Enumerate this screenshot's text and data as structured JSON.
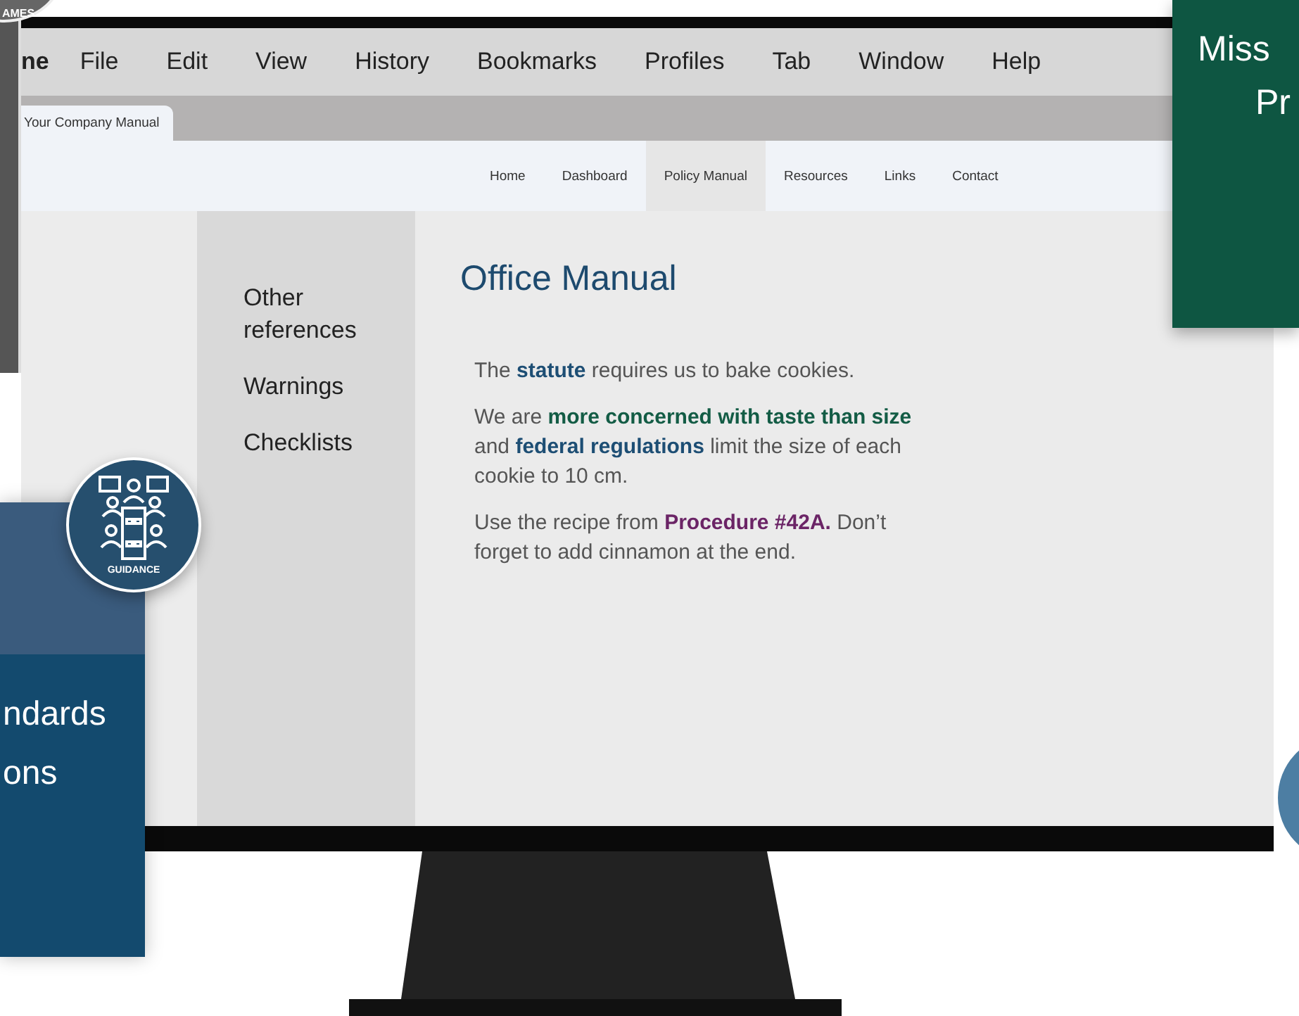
{
  "menu_bar": {
    "items": [
      {
        "label": "ne",
        "kind": "app"
      },
      {
        "label": "File",
        "kind": "menu"
      },
      {
        "label": "Edit",
        "kind": "menu"
      },
      {
        "label": "View",
        "kind": "menu"
      },
      {
        "label": "History",
        "kind": "menu"
      },
      {
        "label": "Bookmarks",
        "kind": "menu"
      },
      {
        "label": "Profiles",
        "kind": "menu"
      },
      {
        "label": "Tab",
        "kind": "menu"
      },
      {
        "label": "Window",
        "kind": "menu"
      },
      {
        "label": "Help",
        "kind": "menu"
      }
    ]
  },
  "browser_tab": {
    "title": "Your Company Manual"
  },
  "site_nav": [
    {
      "label": "Home",
      "selected": false
    },
    {
      "label": "Dashboard",
      "selected": false
    },
    {
      "label": "Policy Manual",
      "selected": true
    },
    {
      "label": "Resources",
      "selected": false
    },
    {
      "label": "Links",
      "selected": false
    },
    {
      "label": "Contact",
      "selected": false
    }
  ],
  "sidebar": {
    "items": [
      "Other references",
      "Warnings",
      "Checklists"
    ]
  },
  "article": {
    "title": "Office Manual",
    "paragraphs": [
      [
        {
          "text": "The "
        },
        {
          "text": "statute",
          "color": "#1d4e74"
        },
        {
          "text": " requires us to bake cookies."
        }
      ],
      [
        {
          "text": "We are "
        },
        {
          "text": "more concerned with taste than size",
          "color": "#135c45"
        },
        {
          "text": " and "
        },
        {
          "text": "federal regulations",
          "color": "#1d4e74"
        },
        {
          "text": " limit the size of each cookie to 10 cm."
        }
      ],
      [
        {
          "text": "Use the recipe from "
        },
        {
          "text": "Procedure #42A.",
          "color": "#6b2466"
        },
        {
          "text": " Don’t forget to add cinnamon at the end."
        }
      ]
    ]
  },
  "decor": {
    "top_badge": "AMES",
    "guidance_badge": "GUIDANCE",
    "blue_card": [
      "ndards",
      "ons"
    ],
    "green_card": [
      "Miss",
      "Pr"
    ]
  }
}
